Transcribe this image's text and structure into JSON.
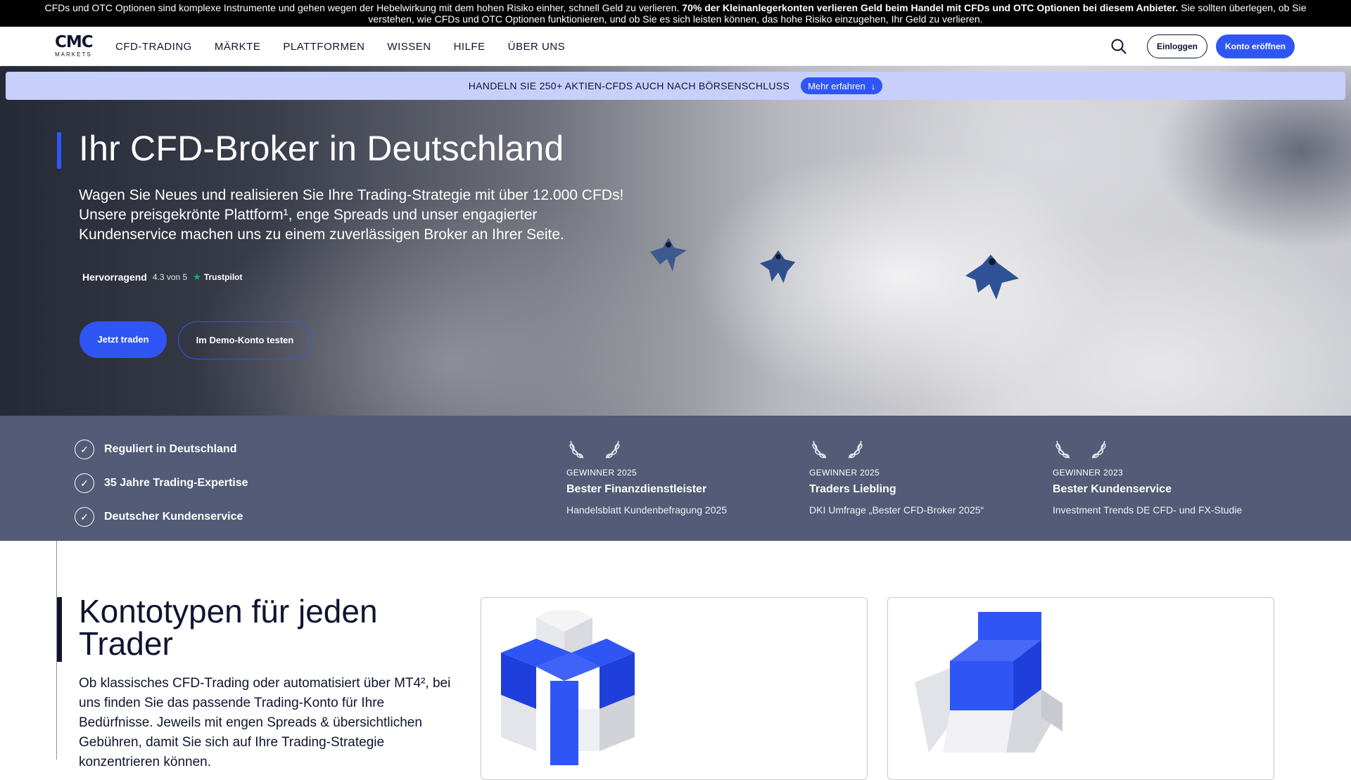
{
  "risk_warning": {
    "text_start": "CFDs und OTC Optionen sind komplexe Instrumente und gehen wegen der Hebelwirkung mit dem hohen Risiko einher, schnell Geld zu verlieren. ",
    "text_bold": "70% der Kleinanlegerkonten verlieren Geld beim Handel mit CFDs und OTC Optionen bei diesem Anbieter.",
    "text_end": " Sie sollten überlegen, ob Sie verstehen, wie CFDs und OTC Optionen funktionieren, und ob Sie es sich leisten können, das hohe Risiko einzugehen, Ihr Geld zu verlieren."
  },
  "header": {
    "logo_mark": "CMC",
    "logo_sub": "MARKETS",
    "nav": [
      "CFD-TRADING",
      "MÄRKTE",
      "PLATTFORMEN",
      "WISSEN",
      "HILFE",
      "ÜBER UNS"
    ],
    "login_label": "Einloggen",
    "open_account_label": "Konto eröffnen"
  },
  "promo": {
    "text": "HANDELN SIE 250+ AKTIEN-CFDS AUCH NACH BÖRSENSCHLUSS",
    "button_label": "Mehr erfahren",
    "button_icon": "arrow-down-icon"
  },
  "hero": {
    "title": "Ihr CFD-Broker in Deutschland",
    "text": "Wagen Sie Neues und realisieren Sie Ihre Trading-Strategie mit über 12.000 CFDs! Unsere preisgekrönte Plattform¹, enge Spreads und unser engagierter Kundenservice machen uns zu einem zuverlässigen Broker an Ihrer Seite.",
    "rating_word": "Hervorragend",
    "rating_score": "4.3 von 5",
    "rating_brand": "Trustpilot",
    "cta_primary": "Jetzt traden",
    "cta_secondary": "Im Demo-Konto testen"
  },
  "usps": [
    "Reguliert in Deutschland",
    "35 Jahre Trading-Expertise",
    "Deutscher Kundenservice"
  ],
  "awards": [
    {
      "year": "GEWINNER 2025",
      "title": "Bester Finanzdienstleister",
      "source": "Handelsblatt Kundenbefragung 2025"
    },
    {
      "year": "GEWINNER 2025",
      "title": "Traders Liebling",
      "source": "DKI Umfrage „Bester CFD-Broker 2025“"
    },
    {
      "year": "GEWINNER 2023",
      "title": "Bester Kundenservice",
      "source": "Investment Trends DE CFD- und FX-Studie"
    }
  ],
  "accounts": {
    "title": "Kontotypen für jeden Trader",
    "text": "Ob klassisches CFD-Trading oder automatisiert über MT4², bei uns finden Sie das passende Trading-Konto für Ihre Bedürfnisse. Jeweils mit engen Spreads & übersichtlichen Gebühren, damit Sie sich auf Ihre Trading-Strategie konzentrieren können."
  },
  "colors": {
    "brand_blue": "#2f56f5",
    "navy": "#0f1530",
    "strip": "#535b76",
    "promo": "#c7d0fb"
  }
}
